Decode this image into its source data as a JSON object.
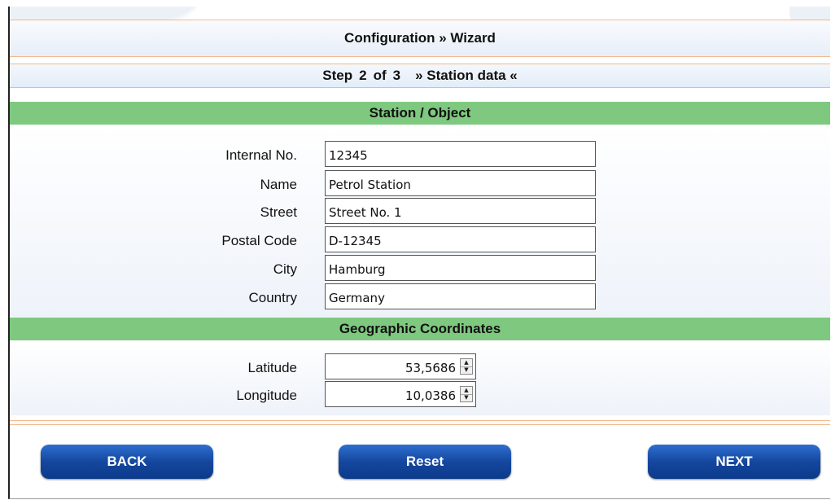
{
  "header": {
    "title": "Configuration  »  Wizard"
  },
  "step": {
    "prefix": "Step",
    "current": "2",
    "of": "of",
    "total": "3",
    "name": "» Station data «"
  },
  "station": {
    "section_title": "Station / Object",
    "fields": [
      {
        "label": "Internal No.",
        "value": "12345"
      },
      {
        "label": "Name",
        "value": "Petrol Station"
      },
      {
        "label": "Street",
        "value": "Street No. 1"
      },
      {
        "label": "Postal Code",
        "value": "D-12345"
      },
      {
        "label": "City",
        "value": "Hamburg"
      },
      {
        "label": "Country",
        "value": "Germany"
      }
    ]
  },
  "geo": {
    "section_title": "Geographic Coordinates",
    "latitude": {
      "label": "Latitude",
      "value": "53,5686"
    },
    "longitude": {
      "label": "Longitude",
      "value": "10,0386"
    }
  },
  "buttons": {
    "back": "BACK",
    "reset": "Reset",
    "next": "NEXT"
  },
  "colors": {
    "section_green": "#7fc87f",
    "button_blue": "#15479e",
    "divider_orange": "#f2b98b"
  }
}
